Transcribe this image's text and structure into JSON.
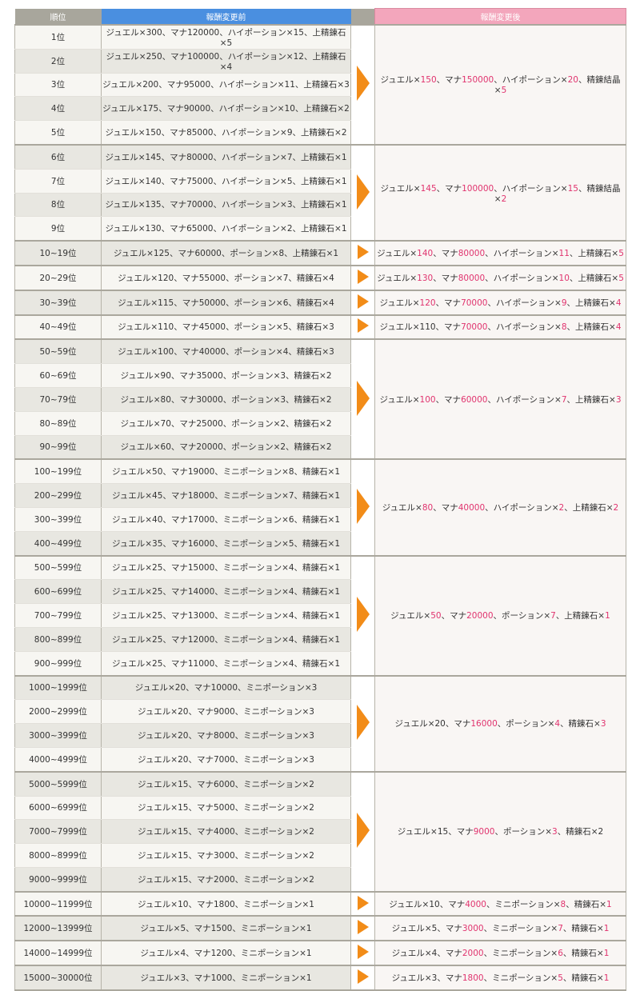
{
  "headers": {
    "rank": "順位",
    "before": "報酬変更前",
    "after": "報酬変更後"
  },
  "groups": [
    {
      "rows": [
        {
          "rank": "1位",
          "before": "ジュエル×300、マナ120000、ハイポーション×15、上精錬石×5"
        },
        {
          "rank": "2位",
          "before": "ジュエル×250、マナ100000、ハイポーション×12、上精錬石×4"
        },
        {
          "rank": "3位",
          "before": "ジュエル×200、マナ95000、ハイポーション×11、上精錬石×3"
        },
        {
          "rank": "4位",
          "before": "ジュエル×175、マナ90000、ハイポーション×10、上精錬石×2"
        },
        {
          "rank": "5位",
          "before": "ジュエル×150、マナ85000、ハイポーション×9、上精錬石×2"
        }
      ],
      "after": [
        {
          "t": "ジュエル×"
        },
        {
          "t": "150",
          "h": true
        },
        {
          "t": "、マナ"
        },
        {
          "t": "150000",
          "h": true
        },
        {
          "t": "、ハイポーション×"
        },
        {
          "t": "20",
          "h": true
        },
        {
          "t": "、精錬結晶×"
        },
        {
          "t": "5",
          "h": true
        }
      ]
    },
    {
      "rows": [
        {
          "rank": "6位",
          "before": "ジュエル×145、マナ80000、ハイポーション×7、上精錬石×1"
        },
        {
          "rank": "7位",
          "before": "ジュエル×140、マナ75000、ハイポーション×5、上精錬石×1"
        },
        {
          "rank": "8位",
          "before": "ジュエル×135、マナ70000、ハイポーション×3、上精錬石×1"
        },
        {
          "rank": "9位",
          "before": "ジュエル×130、マナ65000、ハイポーション×2、上精錬石×1"
        }
      ],
      "after": [
        {
          "t": "ジュエル×"
        },
        {
          "t": "145",
          "h": true
        },
        {
          "t": "、マナ"
        },
        {
          "t": "100000",
          "h": true
        },
        {
          "t": "、ハイポーション×"
        },
        {
          "t": "15",
          "h": true
        },
        {
          "t": "、精錬結晶×"
        },
        {
          "t": "2",
          "h": true
        }
      ]
    },
    {
      "rows": [
        {
          "rank": "10~19位",
          "before": "ジュエル×125、マナ60000、ポーション×8、上精錬石×1"
        }
      ],
      "after": [
        {
          "t": "ジュエル×"
        },
        {
          "t": "140",
          "h": true
        },
        {
          "t": "、マナ"
        },
        {
          "t": "80000",
          "h": true
        },
        {
          "t": "、ハイポーション×"
        },
        {
          "t": "11",
          "h": true
        },
        {
          "t": "、上精錬石×"
        },
        {
          "t": "5",
          "h": true
        }
      ]
    },
    {
      "rows": [
        {
          "rank": "20~29位",
          "before": "ジュエル×120、マナ55000、ポーション×7、精錬石×4"
        }
      ],
      "after": [
        {
          "t": "ジュエル×"
        },
        {
          "t": "130",
          "h": true
        },
        {
          "t": "、マナ"
        },
        {
          "t": "80000",
          "h": true
        },
        {
          "t": "、ハイポーション×"
        },
        {
          "t": "10",
          "h": true
        },
        {
          "t": "、上精錬石×"
        },
        {
          "t": "5",
          "h": true
        }
      ]
    },
    {
      "rows": [
        {
          "rank": "30~39位",
          "before": "ジュエル×115、マナ50000、ポーション×6、精錬石×4"
        }
      ],
      "after": [
        {
          "t": "ジュエル×"
        },
        {
          "t": "120",
          "h": true
        },
        {
          "t": "、マナ"
        },
        {
          "t": "70000",
          "h": true
        },
        {
          "t": "、ハイポーション×"
        },
        {
          "t": "9",
          "h": true
        },
        {
          "t": "、上精錬石×"
        },
        {
          "t": "4",
          "h": true
        }
      ]
    },
    {
      "rows": [
        {
          "rank": "40~49位",
          "before": "ジュエル×110、マナ45000、ポーション×5、精錬石×3"
        }
      ],
      "after": [
        {
          "t": "ジュエル×110、マナ"
        },
        {
          "t": "70000",
          "h": true
        },
        {
          "t": "、ハイポーション×"
        },
        {
          "t": "8",
          "h": true
        },
        {
          "t": "、上精錬石×"
        },
        {
          "t": "4",
          "h": true
        }
      ]
    },
    {
      "rows": [
        {
          "rank": "50~59位",
          "before": "ジュエル×100、マナ40000、ポーション×4、精錬石×3"
        },
        {
          "rank": "60~69位",
          "before": "ジュエル×90、マナ35000、ポーション×3、精錬石×2"
        },
        {
          "rank": "70~79位",
          "before": "ジュエル×80、マナ30000、ポーション×3、精錬石×2"
        },
        {
          "rank": "80~89位",
          "before": "ジュエル×70、マナ25000、ポーション×2、精錬石×2"
        },
        {
          "rank": "90~99位",
          "before": "ジュエル×60、マナ20000、ポーション×2、精錬石×2"
        }
      ],
      "after": [
        {
          "t": "ジュエル×"
        },
        {
          "t": "100",
          "h": true
        },
        {
          "t": "、マナ"
        },
        {
          "t": "60000",
          "h": true
        },
        {
          "t": "、ハイポーション×"
        },
        {
          "t": "7",
          "h": true
        },
        {
          "t": "、上精錬石×"
        },
        {
          "t": "3",
          "h": true
        }
      ]
    },
    {
      "rows": [
        {
          "rank": "100~199位",
          "before": "ジュエル×50、マナ19000、ミニポーション×8、精錬石×1"
        },
        {
          "rank": "200~299位",
          "before": "ジュエル×45、マナ18000、ミニポーション×7、精錬石×1"
        },
        {
          "rank": "300~399位",
          "before": "ジュエル×40、マナ17000、ミニポーション×6、精錬石×1"
        },
        {
          "rank": "400~499位",
          "before": "ジュエル×35、マナ16000、ミニポーション×5、精錬石×1"
        }
      ],
      "after": [
        {
          "t": "ジュエル×"
        },
        {
          "t": "80",
          "h": true
        },
        {
          "t": "、マナ"
        },
        {
          "t": "40000",
          "h": true
        },
        {
          "t": "、ハイポーション×"
        },
        {
          "t": "2",
          "h": true
        },
        {
          "t": "、上精錬石×"
        },
        {
          "t": "2",
          "h": true
        }
      ]
    },
    {
      "rows": [
        {
          "rank": "500~599位",
          "before": "ジュエル×25、マナ15000、ミニポーション×4、精錬石×1"
        },
        {
          "rank": "600~699位",
          "before": "ジュエル×25、マナ14000、ミニポーション×4、精錬石×1"
        },
        {
          "rank": "700~799位",
          "before": "ジュエル×25、マナ13000、ミニポーション×4、精錬石×1"
        },
        {
          "rank": "800~899位",
          "before": "ジュエル×25、マナ12000、ミニポーション×4、精錬石×1"
        },
        {
          "rank": "900~999位",
          "before": "ジュエル×25、マナ11000、ミニポーション×4、精錬石×1"
        }
      ],
      "after": [
        {
          "t": "ジュエル×"
        },
        {
          "t": "50",
          "h": true
        },
        {
          "t": "、マナ"
        },
        {
          "t": "20000",
          "h": true
        },
        {
          "t": "、ポーション×"
        },
        {
          "t": "7",
          "h": true
        },
        {
          "t": "、上精錬石×"
        },
        {
          "t": "1",
          "h": true
        }
      ]
    },
    {
      "rows": [
        {
          "rank": "1000~1999位",
          "before": "ジュエル×20、マナ10000、ミニポーション×3"
        },
        {
          "rank": "2000~2999位",
          "before": "ジュエル×20、マナ9000、ミニポーション×3"
        },
        {
          "rank": "3000~3999位",
          "before": "ジュエル×20、マナ8000、ミニポーション×3"
        },
        {
          "rank": "4000~4999位",
          "before": "ジュエル×20、マナ7000、ミニポーション×3"
        }
      ],
      "after": [
        {
          "t": "ジュエル×20、マナ"
        },
        {
          "t": "16000",
          "h": true
        },
        {
          "t": "、ポーション×"
        },
        {
          "t": "4",
          "h": true
        },
        {
          "t": "、精錬石×"
        },
        {
          "t": "3",
          "h": true
        }
      ]
    },
    {
      "rows": [
        {
          "rank": "5000~5999位",
          "before": "ジュエル×15、マナ6000、ミニポーション×2"
        },
        {
          "rank": "6000~6999位",
          "before": "ジュエル×15、マナ5000、ミニポーション×2"
        },
        {
          "rank": "7000~7999位",
          "before": "ジュエル×15、マナ4000、ミニポーション×2"
        },
        {
          "rank": "8000~8999位",
          "before": "ジュエル×15、マナ3000、ミニポーション×2"
        },
        {
          "rank": "9000~9999位",
          "before": "ジュエル×15、マナ2000、ミニポーション×2"
        }
      ],
      "after": [
        {
          "t": "ジュエル×15、マナ"
        },
        {
          "t": "9000",
          "h": true
        },
        {
          "t": "、ポーション×"
        },
        {
          "t": "3",
          "h": true
        },
        {
          "t": "、精錬石×2"
        }
      ]
    },
    {
      "rows": [
        {
          "rank": "10000~11999位",
          "before": "ジュエル×10、マナ1800、ミニポーション×1"
        }
      ],
      "after": [
        {
          "t": "ジュエル×10、マナ"
        },
        {
          "t": "4000",
          "h": true
        },
        {
          "t": "、ミニポーション×"
        },
        {
          "t": "8",
          "h": true
        },
        {
          "t": "、精錬石×"
        },
        {
          "t": "1",
          "h": true
        }
      ]
    },
    {
      "rows": [
        {
          "rank": "12000~13999位",
          "before": "ジュエル×5、マナ1500、ミニポーション×1"
        }
      ],
      "after": [
        {
          "t": "ジュエル×5、マナ"
        },
        {
          "t": "3000",
          "h": true
        },
        {
          "t": "、ミニポーション×"
        },
        {
          "t": "7",
          "h": true
        },
        {
          "t": "、精錬石×"
        },
        {
          "t": "1",
          "h": true
        }
      ]
    },
    {
      "rows": [
        {
          "rank": "14000~14999位",
          "before": "ジュエル×4、マナ1200、ミニポーション×1"
        }
      ],
      "after": [
        {
          "t": "ジュエル×4、マナ"
        },
        {
          "t": "2000",
          "h": true
        },
        {
          "t": "、ミニポーション×"
        },
        {
          "t": "6",
          "h": true
        },
        {
          "t": "、精錬石×"
        },
        {
          "t": "1",
          "h": true
        }
      ]
    },
    {
      "rows": [
        {
          "rank": "15000~30000位",
          "before": "ジュエル×3、マナ1000、ミニポーション×1"
        }
      ],
      "after": [
        {
          "t": "ジュエル×3、マナ"
        },
        {
          "t": "1800",
          "h": true
        },
        {
          "t": "、ミニポーション×"
        },
        {
          "t": "5",
          "h": true
        },
        {
          "t": "、精錬石×"
        },
        {
          "t": "1",
          "h": true
        }
      ]
    }
  ],
  "icons": {
    "arrow": "arrow-right-icon"
  },
  "colors": {
    "highlight": "#e0336e",
    "arrow": "#f28c18",
    "header_before": "#4a8fe0",
    "header_after": "#f3a6bc"
  }
}
